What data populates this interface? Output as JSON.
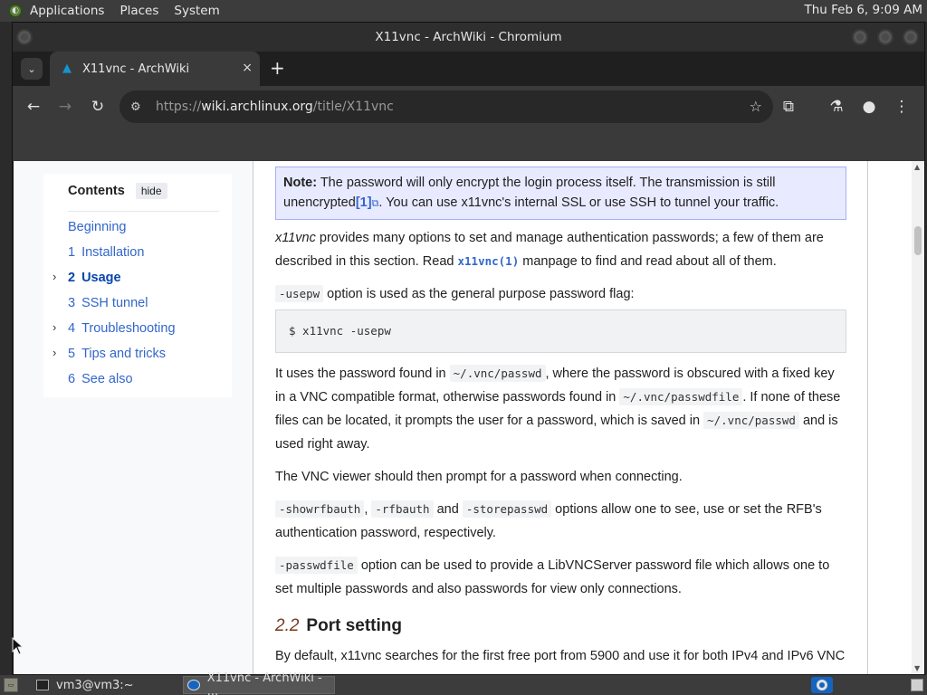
{
  "top_panel": {
    "menus": [
      "Applications",
      "Places",
      "System"
    ],
    "clock": "Thu Feb  6,  9:09 AM"
  },
  "window": {
    "title": "X11vnc - ArchWiki - Chromium"
  },
  "tab": {
    "title": "X11vnc - ArchWiki",
    "favicon": "archlinux-logo-icon",
    "close": "×",
    "new_tab": "+"
  },
  "toolbar": {
    "url_scheme": "https://",
    "url_host": "wiki.archlinux.org",
    "url_path": "/title/X11vnc"
  },
  "toc": {
    "title": "Contents",
    "hide_label": "hide",
    "items": [
      {
        "num": "",
        "label": "Beginning",
        "expandable": false,
        "active": false
      },
      {
        "num": "1",
        "label": "Installation",
        "expandable": false,
        "active": false
      },
      {
        "num": "2",
        "label": "Usage",
        "expandable": true,
        "active": true
      },
      {
        "num": "3",
        "label": "SSH tunnel",
        "expandable": false,
        "active": false
      },
      {
        "num": "4",
        "label": "Troubleshooting",
        "expandable": true,
        "active": false
      },
      {
        "num": "5",
        "label": "Tips and tricks",
        "expandable": true,
        "active": false
      },
      {
        "num": "6",
        "label": "See also",
        "expandable": false,
        "active": false
      }
    ]
  },
  "content": {
    "note_label": "Note:",
    "note_text_1": " The password will only encrypt the login process itself. The transmission is still unencrypted",
    "note_ref": "[1]",
    "note_text_2": ". You can use x11vnc's internal SSL or use SSH to tunnel your traffic.",
    "p1_em": "x11vnc",
    "p1_text_1": " provides many options to set and manage authentication passwords; a few of them are described in this section. Read ",
    "p1_man": "x11vnc(1)",
    "p1_text_2": " manpage to find and read about all of them.",
    "p2_code": "-usepw",
    "p2_text": " option is used as the general purpose password flag:",
    "codeblock": "$ x11vnc -usepw",
    "p3_text_1": "It uses the password found in ",
    "p3_code_1": "~/.vnc/passwd",
    "p3_text_2": ", where the password is obscured with a fixed key in a VNC compatible format, otherwise passwords found in ",
    "p3_code_2": "~/.vnc/passwdfile",
    "p3_text_3": ". If none of these files can be located, it prompts the user for a password, which is saved in ",
    "p3_code_3": "~/.vnc/passwd",
    "p3_text_4": " and is used right away.",
    "p4_text": "The VNC viewer should then prompt for a password when connecting.",
    "p5_code_1": "-showrfbauth",
    "p5_sep_1": ", ",
    "p5_code_2": "-rfbauth",
    "p5_sep_2": " and ",
    "p5_code_3": "-storepasswd",
    "p5_text": " options allow one to see, use or set the RFB's authentication password, respectively.",
    "p6_code": "-passwdfile",
    "p6_text": " option can be used to provide a LibVNCServer password file which allows one to set multiple passwords and also passwords for view only connections.",
    "h_num": "2.2",
    "h_title": "Port setting",
    "p7_text": "By default, x11vnc searches for the first free port from 5900 and use it for both IPv4 and IPv6 VNC"
  },
  "taskbar": {
    "terminal_label": "vm3@vm3:~",
    "browser_label": "X11vnc - ArchWiki - ..."
  }
}
